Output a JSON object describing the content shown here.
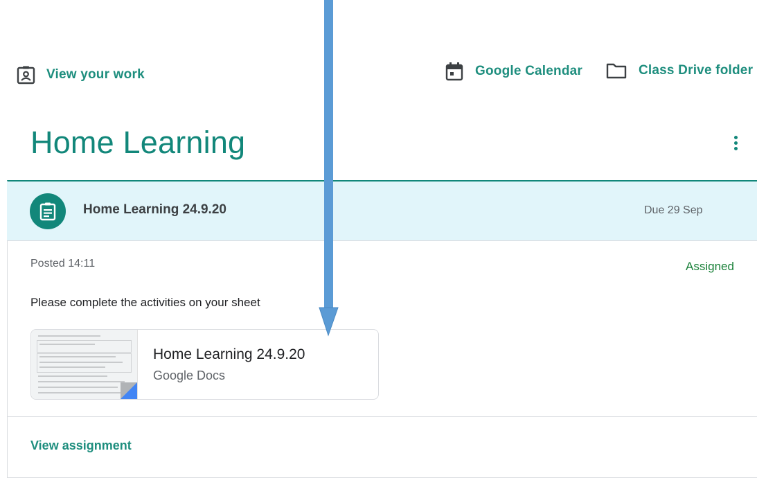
{
  "header": {
    "view_work_label": "View your work",
    "calendar_label": "Google Calendar",
    "drive_label": "Class Drive folder"
  },
  "topic": {
    "title": "Home Learning"
  },
  "assignment": {
    "title": "Home Learning 24.9.20",
    "due": "Due 29 Sep",
    "posted": "Posted 14:11",
    "status": "Assigned",
    "description": "Please complete the activities on your sheet",
    "attachment": {
      "title": "Home Learning 24.9.20",
      "type": "Google Docs"
    },
    "view_label": "View assignment"
  },
  "icons": {
    "view_work": "assignment-ind-icon",
    "calendar": "calendar-icon",
    "drive": "folder-icon",
    "more": "more-vert-icon",
    "assignment": "assignment-icon"
  },
  "colors": {
    "theme": "#12877a",
    "header_bg": "#e1f5fa",
    "status": "#188038",
    "annotation_arrow": "#5b9bd5",
    "docs_blue": "#4285f4"
  }
}
